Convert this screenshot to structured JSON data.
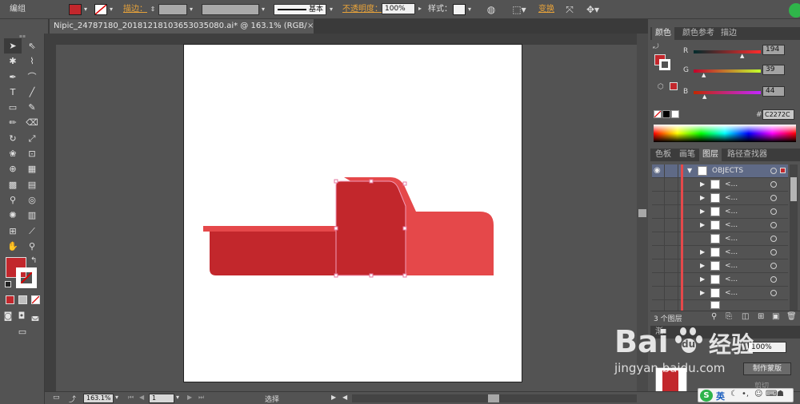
{
  "control_bar": {
    "mode_label": "编组",
    "stroke_label": "描边：",
    "line_style_label": "基本",
    "opacity_label": "不透明度：",
    "opacity_value": "100%",
    "style_label": "样式：",
    "transform_label": "变换"
  },
  "document_tab": {
    "title": "Nipic_24787180_20181218103653035080.ai* @ 163.1% (RGB/预览)",
    "close": "×"
  },
  "color_panel": {
    "tabs": [
      "颜色",
      "颜色参考",
      "描边"
    ],
    "r_label": "R",
    "r_value": "194",
    "g_label": "G",
    "g_value": "39",
    "b_label": "B",
    "b_value": "44",
    "hex_label": "#",
    "hex_value": "C2272C"
  },
  "layers_panel": {
    "tabs": [
      "色板",
      "画笔",
      "图层",
      "路径查找器"
    ],
    "top_layer_name": "OBJECTS",
    "sublayer_label": "<...",
    "footer_label": "3 个图层"
  },
  "transparency_panel": {
    "tab_label": "渐",
    "opacity_value": "100%",
    "make_mask_button": "制作蒙版",
    "clip_label": "剪切"
  },
  "status_bar": {
    "zoom": "163.1%",
    "page": "1",
    "tool_label": "选择"
  },
  "watermark": {
    "text_baidu": "Bai",
    "text_du": "du",
    "text_jingyan": "经验",
    "url": "jingyan.baidu.com"
  },
  "tray": {
    "ime_label": "英"
  },
  "colors": {
    "accent_red": "#c2272c",
    "light_red": "#e5484a",
    "panel_bg": "#535353"
  }
}
